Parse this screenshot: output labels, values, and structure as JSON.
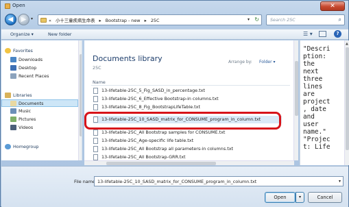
{
  "window": {
    "title": "Open",
    "close_label": "✕"
  },
  "nav": {
    "back_glyph": "◀",
    "forward_glyph": "▶",
    "recent_glyph": "▾",
    "breadcrumbs": [
      "«",
      "小十三童疾病生命表",
      "▸",
      "Bootstrap - new",
      "▸",
      "25C"
    ],
    "address_dropdown": "▾",
    "refresh_glyph": "↻",
    "search_placeholder": "Search 25C"
  },
  "toolbar": {
    "organize": "Organize ▾",
    "new_folder": "New folder",
    "view_glyph": "☰ ▾",
    "help_glyph": "?"
  },
  "sidebar": {
    "items": [
      {
        "label": "Favorites",
        "icon": "star-icon"
      },
      {
        "label": "Downloads",
        "icon": "downloads-icon"
      },
      {
        "label": "Desktop",
        "icon": "desktop-icon"
      },
      {
        "label": "Recent Places",
        "icon": "recent-places-icon"
      },
      {
        "label": "Libraries",
        "icon": "libraries-icon"
      },
      {
        "label": "Documents",
        "icon": "documents-icon"
      },
      {
        "label": "Music",
        "icon": "music-icon"
      },
      {
        "label": "Pictures",
        "icon": "pictures-icon"
      },
      {
        "label": "Videos",
        "icon": "videos-icon"
      },
      {
        "label": "Homegroup",
        "icon": "homegroup-icon"
      }
    ]
  },
  "library": {
    "title": "Documents library",
    "subtitle": "25C",
    "arrange_label": "Arrange by:",
    "arrange_value": "Folder ▾",
    "column_name": "Name",
    "files": [
      "13-lifetable-25C_5_Fig_SASD_in_percentage.txt",
      "13-lifetable-25C_6_Effective Bootstrap-in columns.txt",
      "13-lifetable-25C_8_Fig_BootstrapLifeTable.txt",
      "13-lifetable-25C_10_SASD_matrix_for_CONSUME_program_in_column.txt",
      "13-lifetable-25C_All Bootstrap samples for CONSUME.txt",
      "13-lifetable-25C_Age-specific life table.txt",
      "13-lifetable-25C_All Bootstrap all parameters-in columns.txt",
      "13-lifetable-25C_All Bootstrap-GRR.txt"
    ],
    "selected_index": 3
  },
  "preview": {
    "text": "\"Descri\nption:\nthe\nnext\nthree\nlines\nare\nproject\n, date\nand\nuser\nname.\"\n\"Projec\nt: Life"
  },
  "bottom": {
    "file_name_label": "File name:",
    "file_name_value": "13-lifetable-25C_10_SASD_matrix_for_CONSUME_program_in_column.txt",
    "file_name_dropdown": "▾",
    "open_label": "Open",
    "open_dropdown": "▾",
    "cancel_label": "Cancel"
  },
  "colors": {
    "highlight": "#d7141a",
    "selection": "#cde6f7",
    "title_link": "#1d3d6b"
  }
}
